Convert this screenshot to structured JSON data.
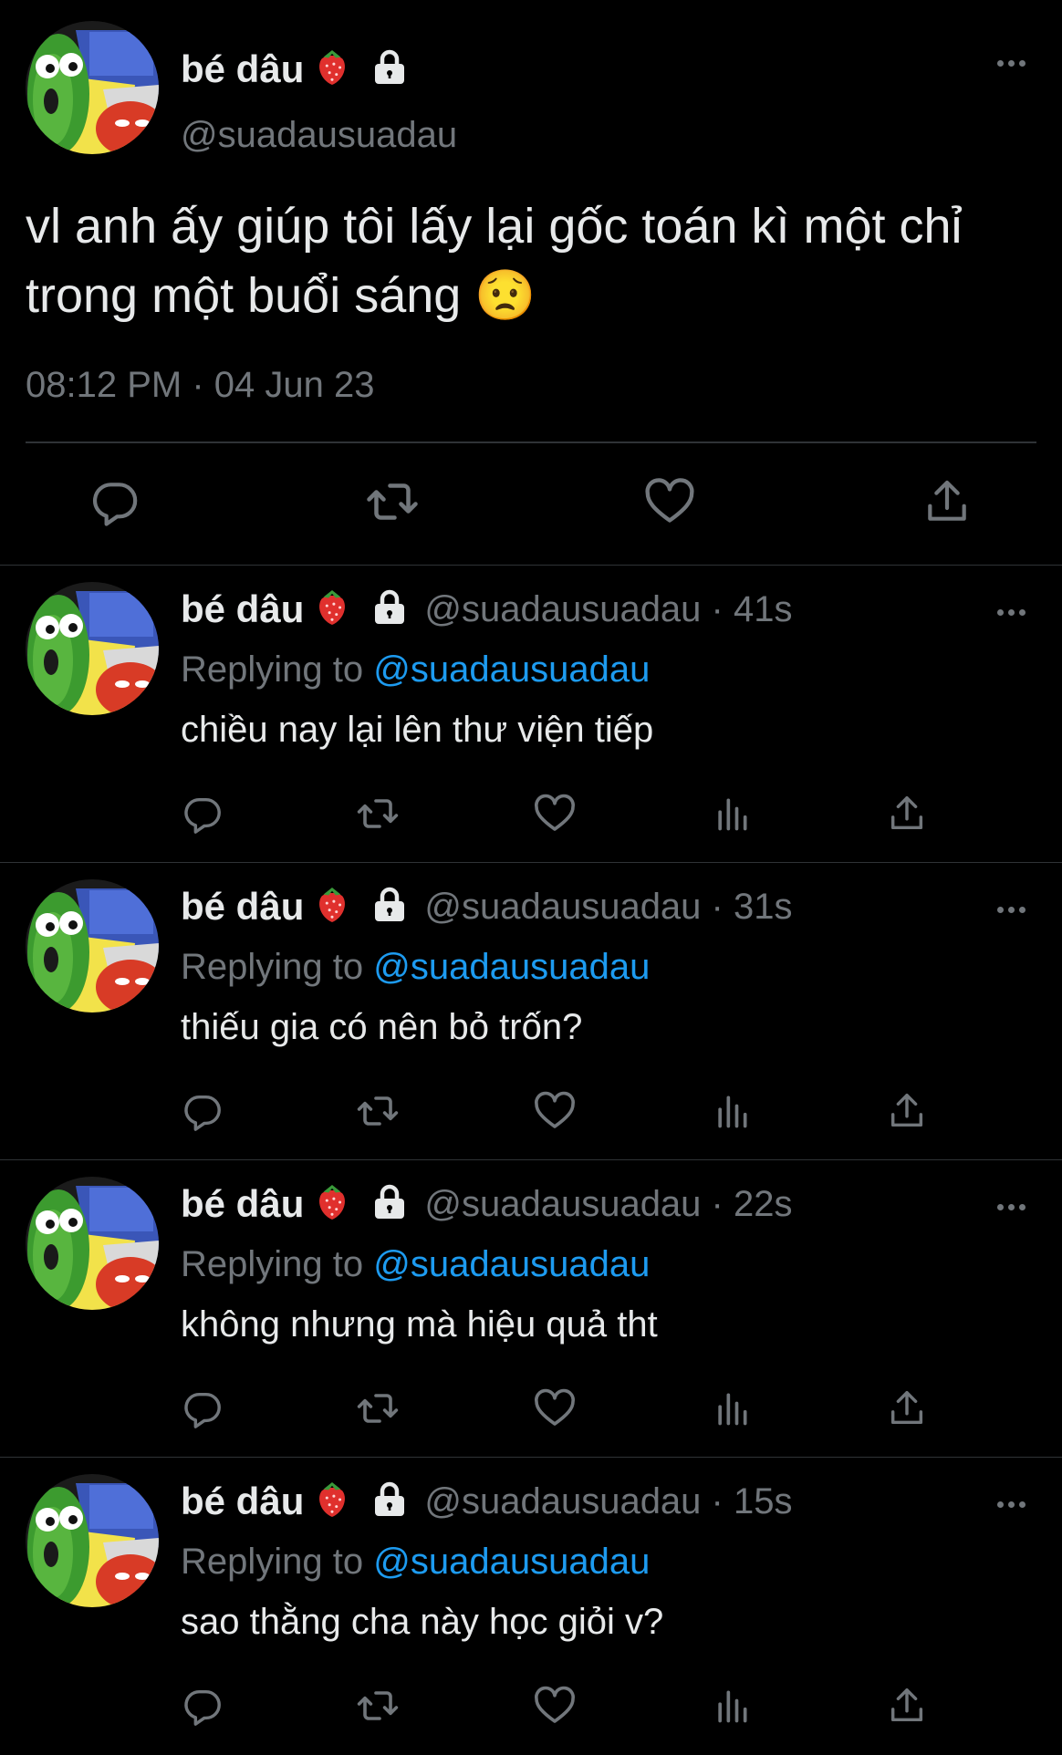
{
  "main_tweet": {
    "author_name": "bé dâu",
    "name_emoji": "🍓",
    "lock_icon": "lock-icon",
    "handle": "@suadausuadau",
    "text": "vl anh ấy giúp tôi lấy lại gốc toán kì một chỉ trong một buổi sáng 😟",
    "timestamp": "08:12 PM · 04 Jun 23",
    "actions": [
      "reply-icon",
      "retweet-icon",
      "like-icon",
      "share-icon"
    ]
  },
  "replies": [
    {
      "author_name": "bé dâu",
      "name_emoji": "🍓",
      "handle_time": "@suadausuadau · 41s",
      "replying_prefix": "Replying to",
      "replying_to": "@suadausuadau",
      "text": "chiều nay lại lên thư viện tiếp"
    },
    {
      "author_name": "bé dâu",
      "name_emoji": "🍓",
      "handle_time": "@suadausuadau · 31s",
      "replying_prefix": "Replying to",
      "replying_to": "@suadausuadau",
      "text": "thiếu gia có nên bỏ trốn?"
    },
    {
      "author_name": "bé dâu",
      "name_emoji": "🍓",
      "handle_time": "@suadausuadau · 22s",
      "replying_prefix": "Replying to",
      "replying_to": "@suadausuadau",
      "text": "không nhưng mà hiệu quả tht"
    },
    {
      "author_name": "bé dâu",
      "name_emoji": "🍓",
      "handle_time": "@suadausuadau · 15s",
      "replying_prefix": "Replying to",
      "replying_to": "@suadausuadau",
      "text": "sao thằng cha này học giỏi v?"
    }
  ],
  "colors": {
    "background": "#000000",
    "text": "#e7e9ea",
    "secondary": "#71767b",
    "link": "#1d9bf0",
    "divider": "#2f3336"
  }
}
